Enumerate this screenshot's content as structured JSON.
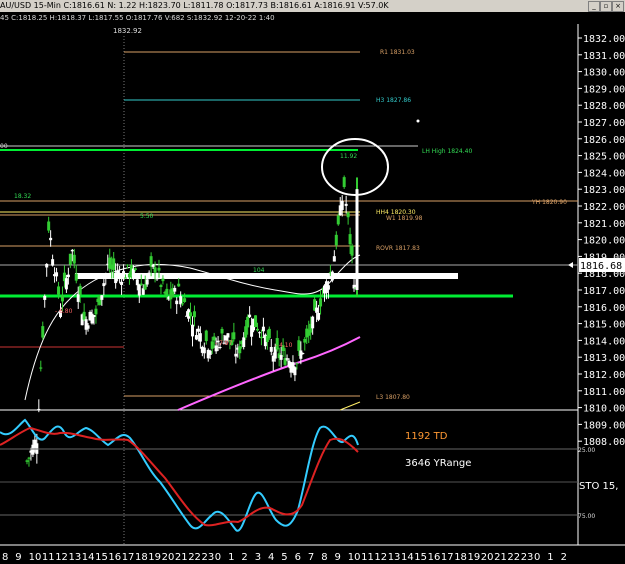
{
  "title_bar": {
    "text": "AU/USD  15-Min  C:1816.61  N:  1.22  H:1823.70  L:1811.78  O:1817.73  B:1816.61  A:1816.91  V:57.0K",
    "buttons": [
      "minimize",
      "restore",
      "close"
    ]
  },
  "info_bar": {
    "text": "45  C:1818.25  H:1818.37  L:1817.55  O:1817.76  V:682  S:1832.92  12-20-22  1:40"
  },
  "cursor_price": "1832.92",
  "price_axis": {
    "ticks": [
      "1832.00",
      "1831.00",
      "1830.00",
      "1829.00",
      "1828.00",
      "1827.00",
      "1826.00",
      "1825.00",
      "1824.00",
      "1823.00",
      "1822.00",
      "1821.00",
      "1820.00",
      "1819.00",
      "1818.00",
      "1817.00",
      "1816.00",
      "1815.00",
      "1814.00",
      "1813.00",
      "1812.00",
      "1811.00",
      "1810.00",
      "1809.00",
      "1808.00"
    ],
    "last_price": "1816.68"
  },
  "levels": {
    "r1": "R1 1831.03",
    "h3": "H3 1827.86",
    "lh_high": "LH High 1824.40",
    "yh": "YH 1820.90",
    "hh4": "HH4 1820.30",
    "w1": "W1 1819.98",
    "rovr": "ROVR 1817.83",
    "l3": "L3 1807.80",
    "left_00": "00"
  },
  "annotations": {
    "peak_left": "18.32",
    "peak_mid": "5.50",
    "peak_right": "11.92",
    "low_1": "- 6.80",
    "low_2": "- 7.97",
    "low_3": "- 4.10",
    "mark_104": "104"
  },
  "oscillator": {
    "td_label": "1192 TD",
    "yrange_label": "3646 YRange",
    "sto_label": "STO  15,",
    "level_25": "25.00",
    "level_75": "75.00"
  },
  "time_axis": {
    "labels": [
      "8",
      "9",
      "10",
      "11",
      "12",
      "13",
      "14",
      "15",
      "16",
      "17",
      "18",
      "19",
      "20",
      "21",
      "22",
      "23",
      "0",
      "1",
      "2",
      "3",
      "4",
      "5",
      "6",
      "7",
      "8",
      "9",
      "10",
      "11",
      "12",
      "13",
      "14",
      "15",
      "16",
      "17",
      "18",
      "19",
      "20",
      "21",
      "22",
      "23",
      "0",
      "1",
      "2"
    ]
  },
  "chart_data": {
    "type": "candlestick",
    "title": "",
    "xlabel": "",
    "ylabel": "",
    "ylim": [
      1807.5,
      1832.9
    ],
    "x": [
      "8",
      "9",
      "10",
      "11",
      "12",
      "13",
      "14",
      "15",
      "16",
      "17",
      "18",
      "19",
      "20",
      "21",
      "22",
      "23",
      "0",
      "1",
      "2",
      "3",
      "4",
      "5",
      "6",
      "7",
      "8",
      "9",
      "10",
      "11"
    ],
    "close": [
      1808.2,
      1820.8,
      1816.0,
      1819.3,
      1815.2,
      1815.6,
      1818.4,
      1817.9,
      1818.1,
      1817.2,
      1818.4,
      1816.4,
      1816.9,
      1815.5,
      1814.1,
      1813.6,
      1814.4,
      1813.2,
      1815.4,
      1814.6,
      1813.2,
      1813.0,
      1812.8,
      1814.2,
      1816.4,
      1818.3,
      1823.2,
      1816.7
    ],
    "colors": {
      "up": "#ffffff",
      "down": "#33cc33",
      "support": "#00ee33",
      "ma_fast": "#ffffff",
      "ma_slow": "#ff66ff"
    }
  }
}
